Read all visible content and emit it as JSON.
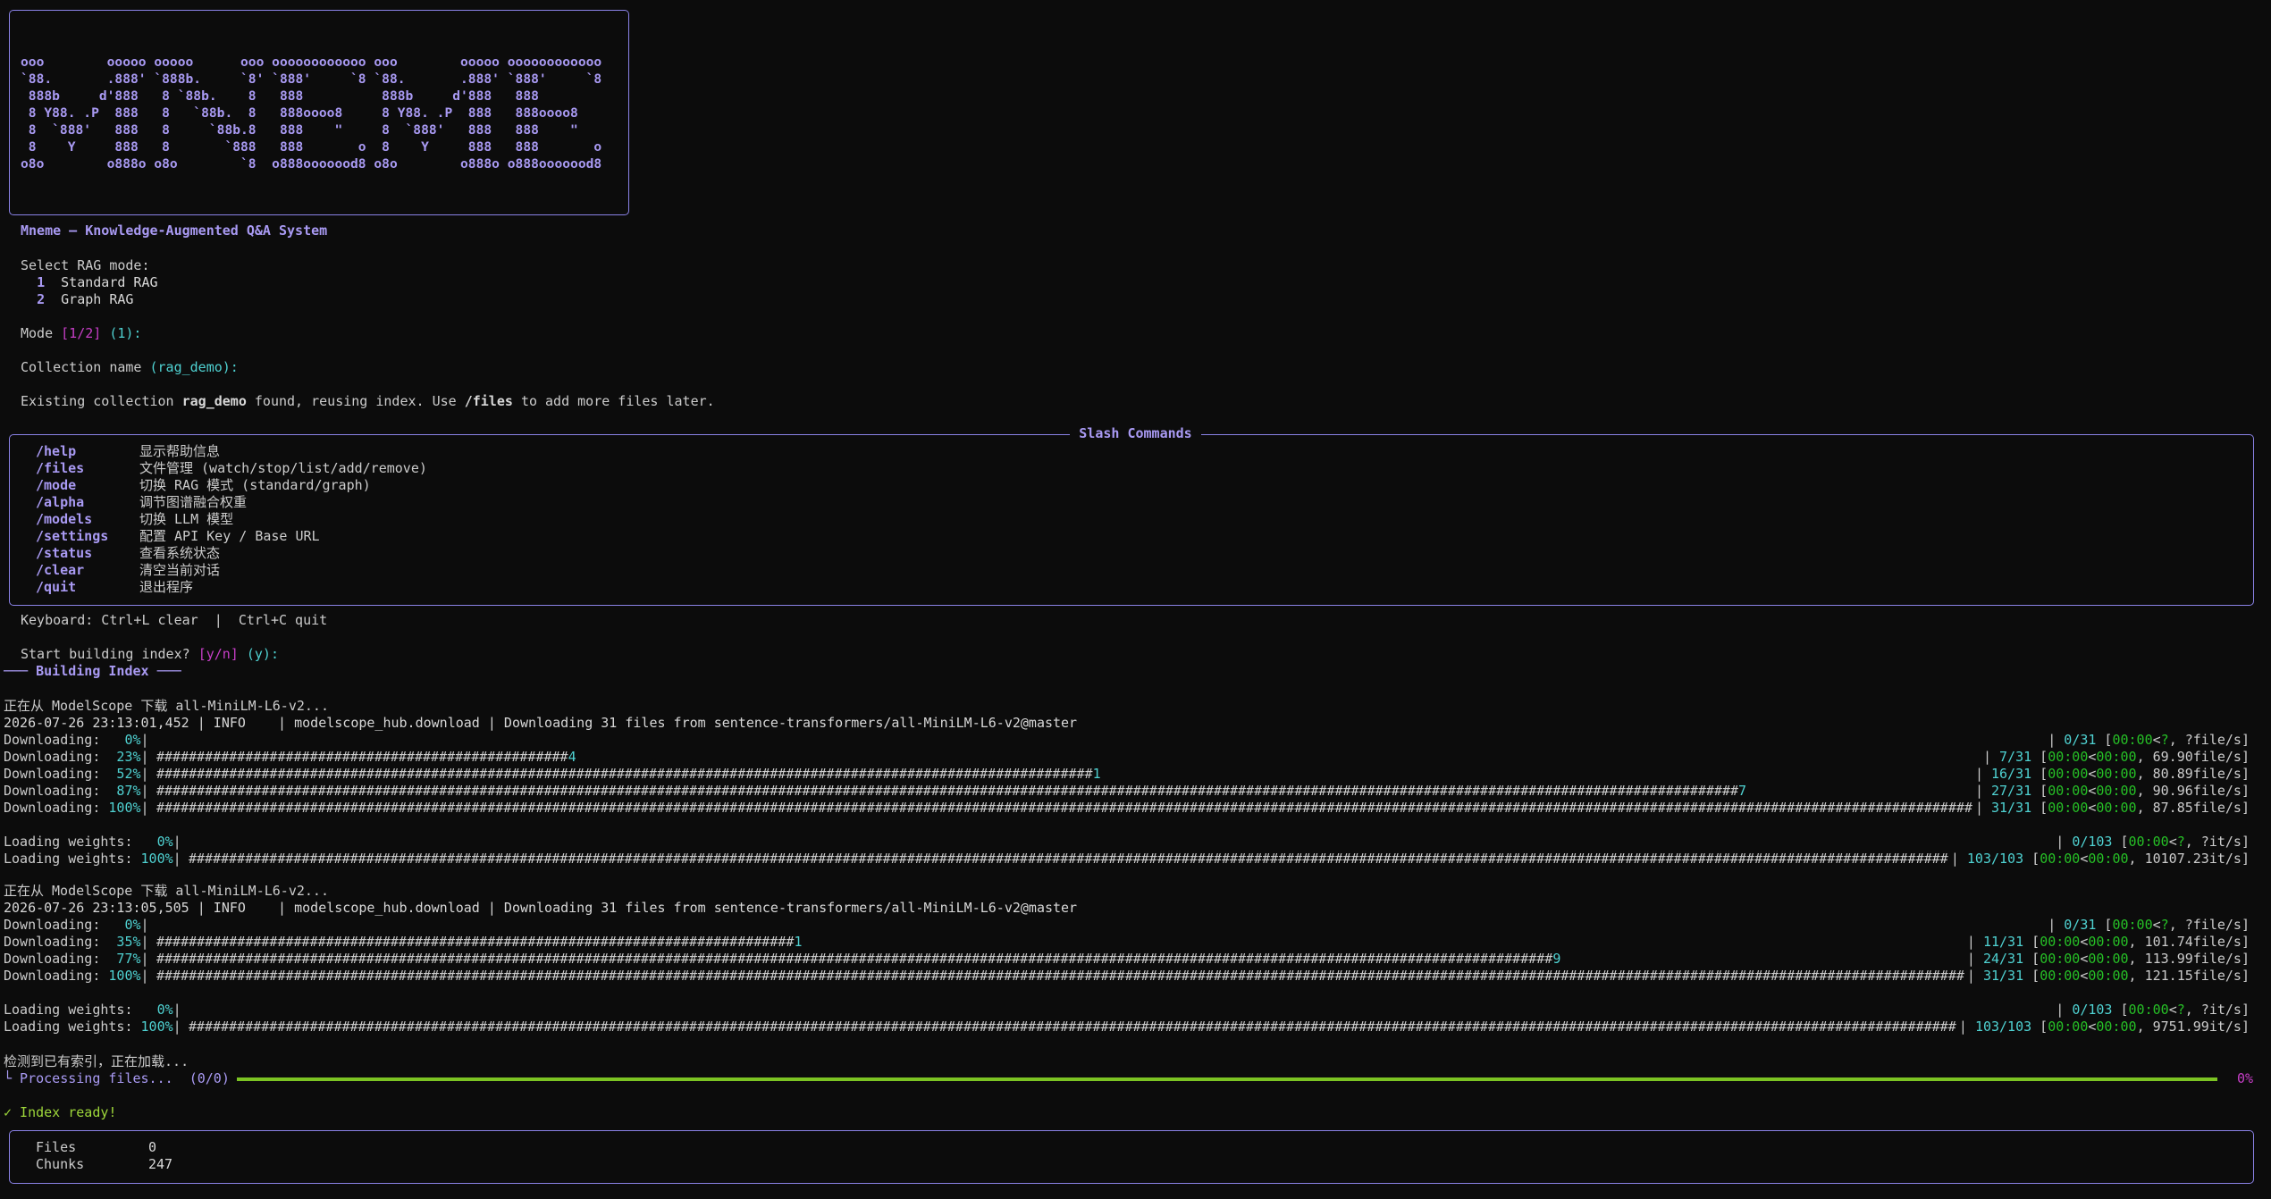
{
  "banner": {
    "ascii": "ooo        ooooo ooooo      ooo oooooooooooo ooo        ooooo oooooooooooo\n`88.       .888' `888b.     `8' `888'     `8 `88.       .888' `888'     `8\n 888b     d'888   8 `88b.    8   888          888b     d'888   888\n 8 Y88. .P  888   8   `88b.  8   888oooo8     8 Y88. .P  888   888oooo8\n 8  `888'   888   8     `88b.8   888    \"     8  `888'   888   888    \"\n 8    Y     888   8       `888   888       o  8    Y     888   888       o\no8o        o888o o8o        `8  o888ooooood8 o8o        o888o o888ooooood8"
  },
  "app_title": "Mneme — Knowledge-Augmented Q&A System",
  "mode_select": {
    "prompt": "Select RAG mode:",
    "options": [
      {
        "num": "1",
        "label": "Standard RAG"
      },
      {
        "num": "2",
        "label": "Graph RAG"
      }
    ],
    "mode_label": "Mode",
    "mode_choices": "[1/2]",
    "mode_default": "(1):"
  },
  "collection": {
    "label": "Collection name",
    "default": "(rag_demo):",
    "existing_prefix": "Existing collection",
    "name": "rag_demo",
    "existing_middle": "found, reusing index. Use",
    "files_cmd": "/files",
    "existing_suffix": "to add more files later."
  },
  "slash_commands": {
    "title": "Slash Commands",
    "items": [
      {
        "cmd": "/help",
        "desc": "显示帮助信息"
      },
      {
        "cmd": "/files",
        "desc": "文件管理 (watch/stop/list/add/remove)"
      },
      {
        "cmd": "/mode",
        "desc": "切换 RAG 模式 (standard/graph)"
      },
      {
        "cmd": "/alpha",
        "desc": "调节图谱融合权重"
      },
      {
        "cmd": "/models",
        "desc": "切换 LLM 模型"
      },
      {
        "cmd": "/settings",
        "desc": "配置 API Key / Base URL"
      },
      {
        "cmd": "/status",
        "desc": "查看系统状态"
      },
      {
        "cmd": "/clear",
        "desc": "清空当前对话"
      },
      {
        "cmd": "/quit",
        "desc": "退出程序"
      }
    ]
  },
  "keyboard_hint": "Keyboard: Ctrl+L clear  |  Ctrl+C quit",
  "build_prompt": {
    "text": "Start building index?",
    "choices": "[y/n]",
    "default": "(y):"
  },
  "building_header": "─── Building Index ───",
  "log_blocks": [
    {
      "download_msg": "正在从 ModelScope 下载 all-MiniLM-L6-v2...",
      "info": "2026-07-26 23:13:01,452 | INFO    | modelscope_hub.download | Downloading 31 files from sentence-transformers/all-MiniLM-L6-v2@master",
      "downloads": [
        {
          "label": "Downloading:",
          "pct": "  0%",
          "fill": 0,
          "tail": "",
          "count": "0/31",
          "t1": "00:00",
          "t2": "?",
          "rate": ", ?file/s]"
        },
        {
          "label": "Downloading:",
          "pct": " 23%",
          "fill": 0.2258,
          "tail": "4",
          "count": "7/31",
          "t1": "00:00",
          "t2": "00:00",
          "rate": ", 69.90file/s]"
        },
        {
          "label": "Downloading:",
          "pct": " 52%",
          "fill": 0.5161,
          "tail": "1",
          "count": "16/31",
          "t1": "00:00",
          "t2": "00:00",
          "rate": ", 80.89file/s]"
        },
        {
          "label": "Downloading:",
          "pct": " 87%",
          "fill": 0.871,
          "tail": "7",
          "count": "27/31",
          "t1": "00:00",
          "t2": "00:00",
          "rate": ", 90.96file/s]"
        },
        {
          "label": "Downloading:",
          "pct": "100%",
          "fill": 1,
          "tail": "",
          "count": "31/31",
          "t1": "00:00",
          "t2": "00:00",
          "rate": ", 87.85file/s]"
        }
      ],
      "weights": [
        {
          "label": "Loading weights:",
          "pct": "  0%",
          "fill": 0,
          "tail": "",
          "count": "0/103",
          "t1": "00:00",
          "t2": "?",
          "rate": ", ?it/s]"
        },
        {
          "label": "Loading weights:",
          "pct": "100%",
          "fill": 1,
          "tail": "",
          "count": "103/103",
          "t1": "00:00",
          "t2": "00:00",
          "rate": ", 10107.23it/s]"
        }
      ]
    },
    {
      "download_msg": "正在从 ModelScope 下载 all-MiniLM-L6-v2...",
      "info": "2026-07-26 23:13:05,505 | INFO    | modelscope_hub.download | Downloading 31 files from sentence-transformers/all-MiniLM-L6-v2@master",
      "downloads": [
        {
          "label": "Downloading:",
          "pct": "  0%",
          "fill": 0,
          "tail": "",
          "count": "0/31",
          "t1": "00:00",
          "t2": "?",
          "rate": ", ?file/s]"
        },
        {
          "label": "Downloading:",
          "pct": " 35%",
          "fill": 0.3548,
          "tail": "1",
          "count": "11/31",
          "t1": "00:00",
          "t2": "00:00",
          "rate": ", 101.74file/s]"
        },
        {
          "label": "Downloading:",
          "pct": " 77%",
          "fill": 0.7742,
          "tail": "9",
          "count": "24/31",
          "t1": "00:00",
          "t2": "00:00",
          "rate": ", 113.99file/s]"
        },
        {
          "label": "Downloading:",
          "pct": "100%",
          "fill": 1,
          "tail": "",
          "count": "31/31",
          "t1": "00:00",
          "t2": "00:00",
          "rate": ", 121.15file/s]"
        }
      ],
      "weights": [
        {
          "label": "Loading weights:",
          "pct": "  0%",
          "fill": 0,
          "tail": "",
          "count": "0/103",
          "t1": "00:00",
          "t2": "?",
          "rate": ", ?it/s]"
        },
        {
          "label": "Loading weights:",
          "pct": "100%",
          "fill": 1,
          "tail": "",
          "count": "103/103",
          "t1": "00:00",
          "t2": "00:00",
          "rate": ", 9751.99it/s]"
        }
      ]
    }
  ],
  "detect_msg": "检测到已有索引，正在加载...",
  "processing": {
    "prefix": "└ Processing files...",
    "count": "(0/0)",
    "pct": "0%",
    "fill": 1
  },
  "ready": "✓ Index ready!",
  "stats": [
    {
      "label": "Files",
      "value": "0"
    },
    {
      "label": "Chunks",
      "value": "247"
    }
  ]
}
